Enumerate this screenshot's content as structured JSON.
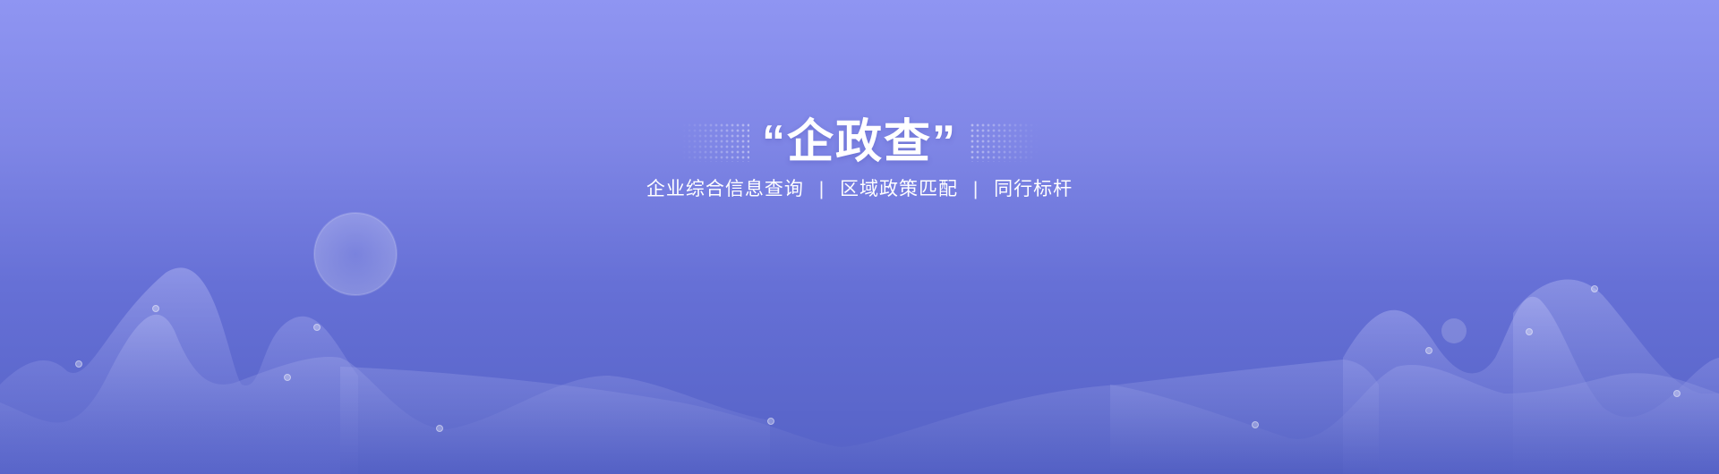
{
  "hero": {
    "title": "“企政查”",
    "subtitle_items": [
      "企业综合信息查询",
      "区域政策匹配",
      "同行标杆"
    ],
    "separator": "|"
  },
  "colors": {
    "background_top": "#8f95f2",
    "background_bottom": "#5562c6",
    "text": "#ffffff"
  }
}
